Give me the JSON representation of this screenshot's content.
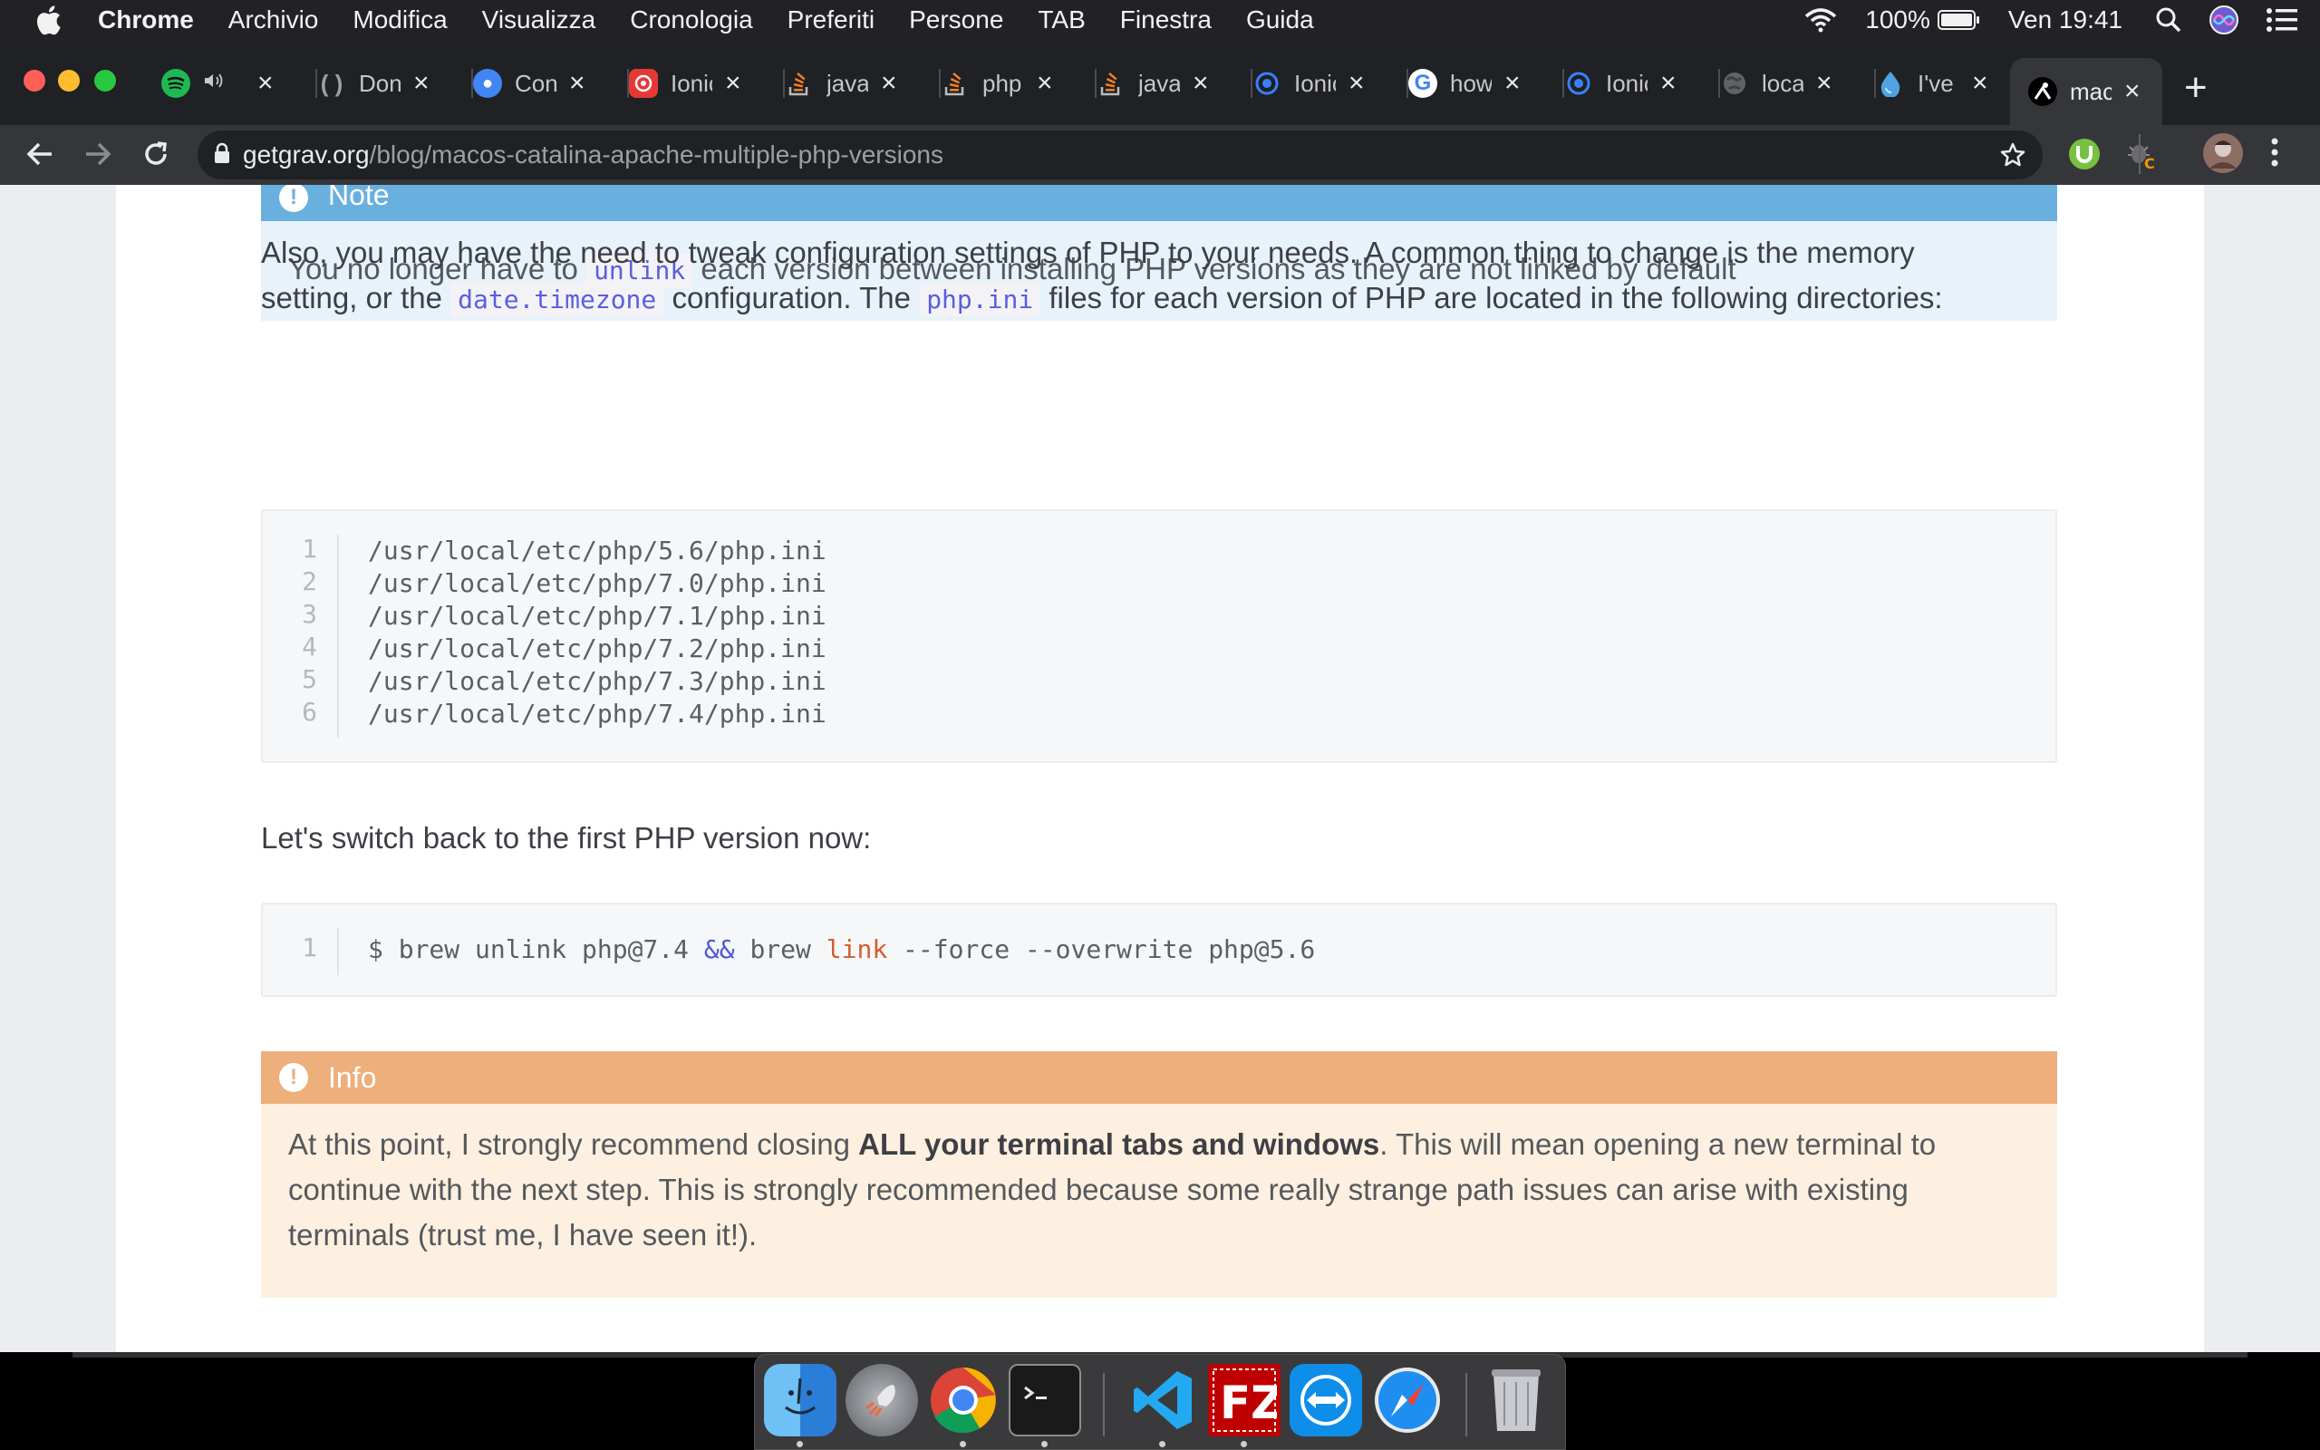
{
  "menubar": {
    "app": "Chrome",
    "items": [
      "Archivio",
      "Modifica",
      "Visualizza",
      "Cronologia",
      "Preferiti",
      "Persone",
      "TAB",
      "Finestra",
      "Guida"
    ],
    "battery": "100%",
    "clock": "Ven 19:41"
  },
  "tabs": [
    {
      "title": "",
      "icon": "spotify-icon",
      "color": "#1db954"
    },
    {
      "title": "Don",
      "icon": "code-brackets-icon",
      "color": "#3c4043"
    },
    {
      "title": "Con",
      "icon": "chat-icon",
      "color": "#4285f4"
    },
    {
      "title": "Ionic",
      "icon": "ionic-icon",
      "color": "#e53935"
    },
    {
      "title": "java",
      "icon": "stackoverflow-icon",
      "color": "#f48024"
    },
    {
      "title": "php",
      "icon": "stackoverflow-icon",
      "color": "#f48024"
    },
    {
      "title": "java",
      "icon": "stackoverflow-icon",
      "color": "#f48024"
    },
    {
      "title": "Ionic",
      "icon": "ionic-icon",
      "color": "#3880ff"
    },
    {
      "title": "how",
      "icon": "google-icon",
      "color": "#ffffff"
    },
    {
      "title": "Ionic",
      "icon": "ionic-icon",
      "color": "#3880ff"
    },
    {
      "title": "loca",
      "icon": "globe-icon",
      "color": "#5f6368"
    },
    {
      "title": "I've",
      "icon": "drop-icon",
      "color": "#4fa3e0"
    },
    {
      "title": "mac",
      "icon": "grav-icon",
      "color": "#ffffff"
    }
  ],
  "address": {
    "host": "getgrav.org",
    "path": "/blog/macos-catalina-apache-multiple-php-versions"
  },
  "page": {
    "note_title": "Note",
    "note_pre": "You no longer have to ",
    "note_code": "unlink",
    "note_post": " each version between installing PHP versions as they are not linked by default",
    "para1_a": "Also, you may have the need to tweak configuration settings of PHP to your needs. A common thing to change is the memory",
    "para1_b": "setting, or the ",
    "para1_code1": "date.timezone",
    "para1_c": " configuration. The ",
    "para1_code2": "php.ini",
    "para1_d": " files for each version of PHP are located in the following directories:",
    "code1_numbers": [
      "1",
      "2",
      "3",
      "4",
      "5",
      "6"
    ],
    "code1_lines": [
      "/usr/local/etc/php/5.6/php.ini",
      "/usr/local/etc/php/7.0/php.ini",
      "/usr/local/etc/php/7.1/php.ini",
      "/usr/local/etc/php/7.2/php.ini",
      "/usr/local/etc/php/7.3/php.ini",
      "/usr/local/etc/php/7.4/php.ini"
    ],
    "para2": "Let's switch back to the first PHP version now:",
    "code2_number": "1",
    "code2_a": "$ brew unlink php@7.4 ",
    "code2_op": "&&",
    "code2_b": " brew ",
    "code2_kw": "link",
    "code2_c": " --force --overwrite php@5.6",
    "info_title": "Info",
    "info_pre": "At this point, I strongly recommend closing ",
    "info_bold": "ALL your terminal tabs and windows",
    "info_post": ". This will mean opening a new terminal to continue with the next step. This is strongly recommended because some really strange path issues can arise with existing terminals (trust me, I have seen it!)."
  },
  "dock": [
    "finder-icon",
    "launchpad-icon",
    "chrome-icon",
    "terminal-icon",
    "vscode-icon",
    "filezilla-icon",
    "teamviewer-icon",
    "safari-icon",
    "trash-icon"
  ],
  "colors": {
    "note": "#6ab0de",
    "info": "#edaf7c",
    "code_inline": "#5a5edf",
    "code_kw": "#d45d2a"
  }
}
